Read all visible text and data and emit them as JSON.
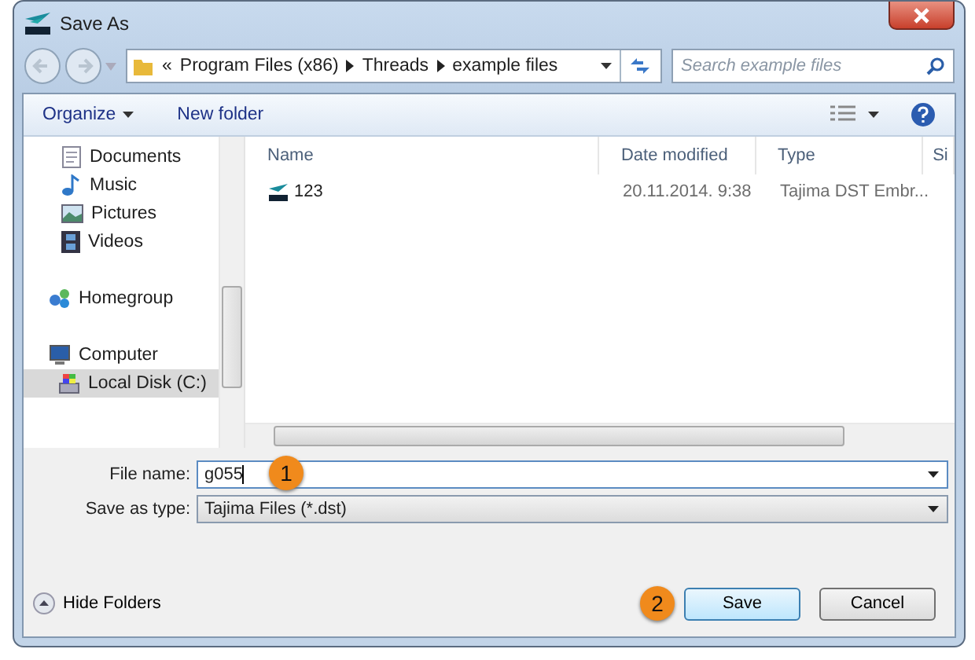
{
  "window": {
    "title": "Save As"
  },
  "address_bar": {
    "overflow": "«",
    "segments": [
      "Program Files (x86)",
      "Threads",
      "example files"
    ]
  },
  "search": {
    "placeholder": "Search example files"
  },
  "toolbar": {
    "items": [
      {
        "label": "Organize",
        "kind": "menu"
      },
      {
        "label": "New folder",
        "kind": "button"
      }
    ]
  },
  "sidebar": {
    "sections": [
      {
        "items": [
          {
            "label": "Documents",
            "kind": "documents",
            "selected": false
          },
          {
            "label": "Music",
            "kind": "music",
            "selected": false
          },
          {
            "label": "Pictures",
            "kind": "pictures",
            "selected": false
          },
          {
            "label": "Videos",
            "kind": "videos",
            "selected": false
          }
        ]
      },
      {
        "items": [
          {
            "label": "Homegroup",
            "kind": "homegroup",
            "selected": false
          }
        ]
      },
      {
        "items": [
          {
            "label": "Computer",
            "kind": "computer",
            "selected": false,
            "children": [
              {
                "label": "Local Disk (C:)",
                "kind": "disk",
                "selected": true
              }
            ]
          }
        ]
      }
    ]
  },
  "table": {
    "columns": [
      "Name",
      "Date modified",
      "Type",
      "Si"
    ],
    "rows": [
      {
        "cells": [
          "123",
          "20.11.2014. 9:38",
          "Tajima DST Embr..."
        ]
      }
    ]
  },
  "file_name": {
    "label": "File name:",
    "value": "g055",
    "marker": "1"
  },
  "save_as_type": {
    "label": "Save as type:",
    "value": "Tajima Files (*.dst)"
  },
  "hide_folders": {
    "label": "Hide Folders"
  },
  "buttons": [
    {
      "label": "Save",
      "kind": "default",
      "marker": "2"
    },
    {
      "label": "Cancel",
      "kind": "normal"
    }
  ]
}
